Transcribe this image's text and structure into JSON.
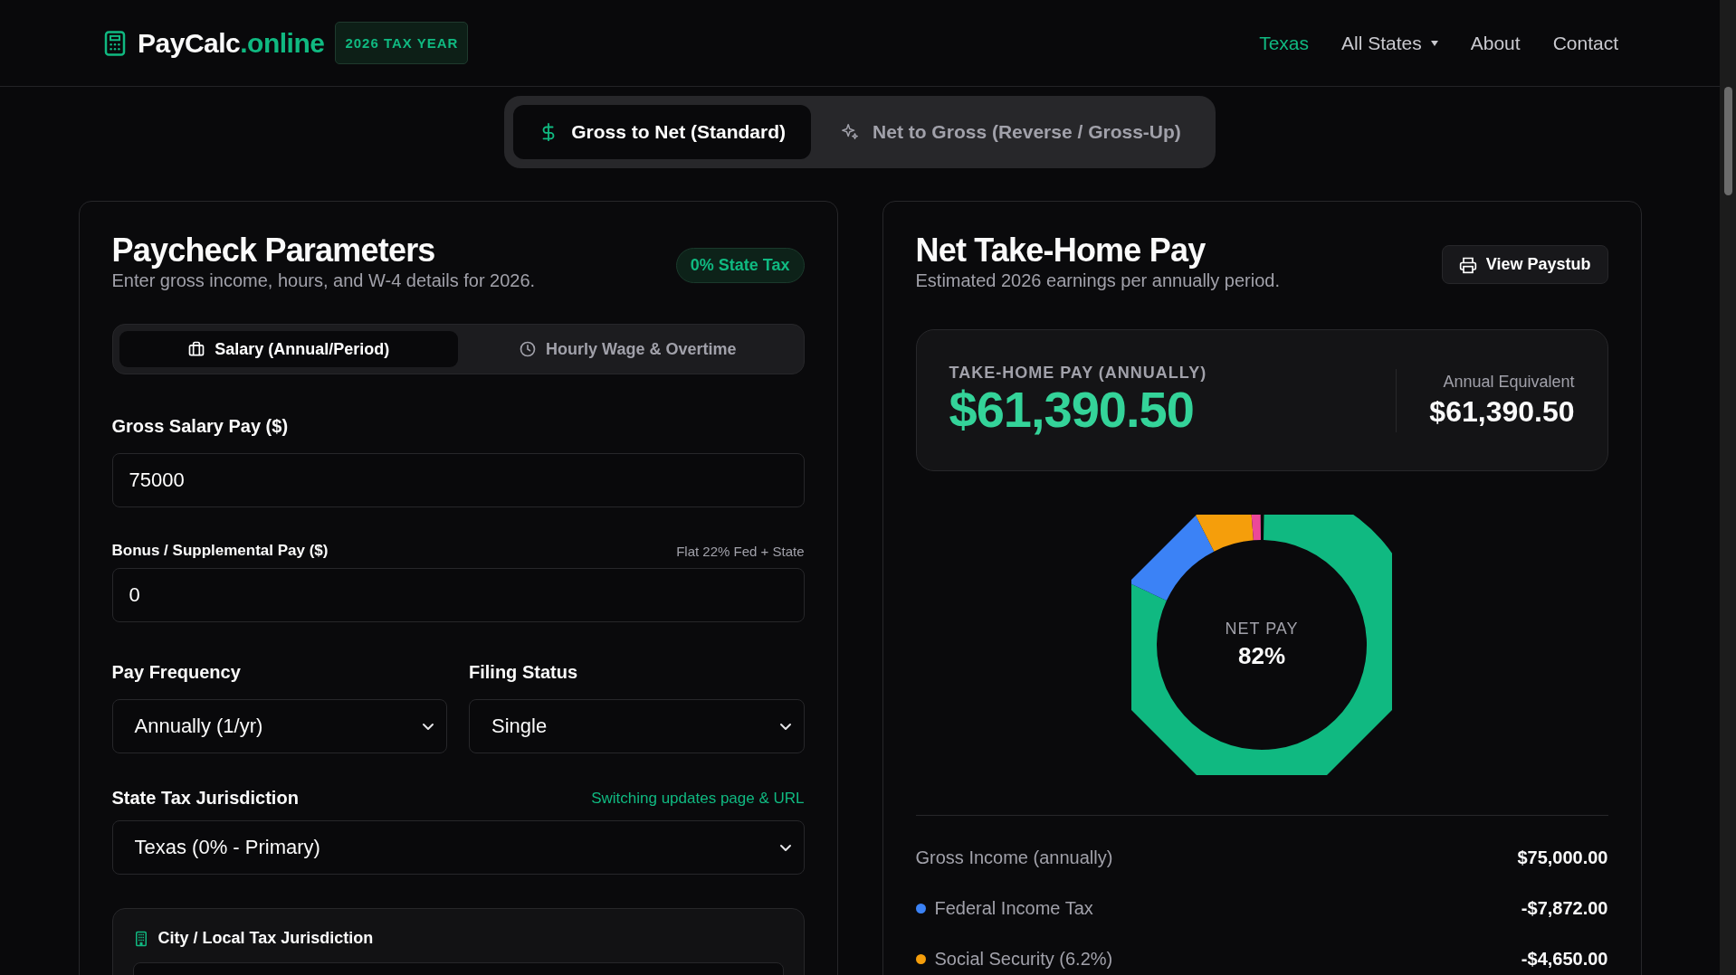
{
  "header": {
    "logo_text": "PayCalc",
    "logo_accent": ".online",
    "badge": "2026 TAX YEAR",
    "nav": [
      {
        "label": "Texas",
        "kind": "link",
        "selected": true
      },
      {
        "label": "All States",
        "kind": "dropdown",
        "selected": false
      },
      {
        "label": "About",
        "kind": "link",
        "selected": false
      },
      {
        "label": "Contact",
        "kind": "link",
        "selected": false
      }
    ]
  },
  "mode_tabs": [
    {
      "label": "Gross to Net (Standard)",
      "selected": true
    },
    {
      "label": "Net to Gross (Reverse / Gross-Up)",
      "selected": false
    }
  ],
  "parameters": {
    "title": "Paycheck Parameters",
    "subtitle": "Enter gross income, hours, and W-4 details for 2026.",
    "badge": "0% State Tax",
    "income_tabs": [
      {
        "label": "Salary (Annual/Period)",
        "selected": true
      },
      {
        "label": "Hourly Wage & Overtime",
        "selected": false
      }
    ],
    "gross_salary": {
      "label": "Gross Salary Pay ($)",
      "value": "75000"
    },
    "bonus": {
      "label": "Bonus / Supplemental Pay ($)",
      "note": "Flat 22% Fed + State",
      "value": "0"
    },
    "pay_frequency": {
      "label": "Pay Frequency",
      "value": "Annually (1/yr)"
    },
    "filing_status": {
      "label": "Filing Status",
      "value": "Single"
    },
    "state": {
      "label": "State Tax Jurisdiction",
      "note": "Switching updates page & URL",
      "value": "Texas (0% - Primary)"
    },
    "city": {
      "title": "City / Local Tax Jurisdiction"
    }
  },
  "results": {
    "title": "Net Take-Home Pay",
    "subtitle": "Estimated 2026 earnings per annually period.",
    "button": "View Paystub",
    "summary": {
      "label": "TAKE-HOME PAY (ANNUALLY)",
      "amount": "$61,390.50",
      "equivalent_label": "Annual Equivalent",
      "equivalent_amount": "$61,390.50"
    },
    "donut": {
      "center_label": "NET PAY",
      "center_value": "82%"
    },
    "breakdown": [
      {
        "label": "Gross Income (annually)",
        "amount": "$75,000.00"
      },
      {
        "label": "Federal Income Tax",
        "amount": "-$7,872.00",
        "color": "#3b82f6"
      },
      {
        "label": "Social Security (6.2%)",
        "amount": "-$4,650.00",
        "color": "#f59e0b"
      }
    ]
  }
}
